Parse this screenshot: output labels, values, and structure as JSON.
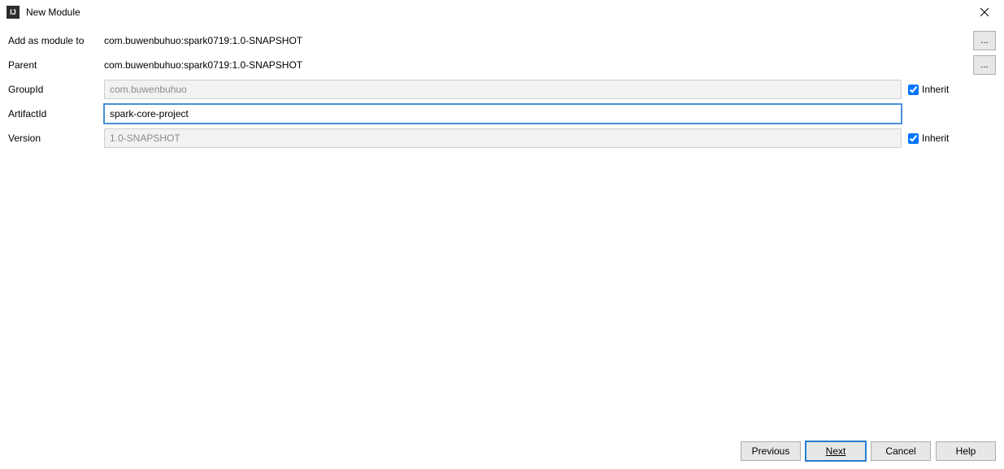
{
  "window": {
    "title": "New Module",
    "icon_label": "IJ"
  },
  "form": {
    "add_as_module_label": "Add as module to",
    "add_as_module_value": "com.buwenbuhuo:spark0719:1.0-SNAPSHOT",
    "parent_label": "Parent",
    "parent_value": "com.buwenbuhuo:spark0719:1.0-SNAPSHOT",
    "group_id_label": "GroupId",
    "group_id_value": "com.buwenbuhuo",
    "group_id_inherit": true,
    "artifact_id_label": "ArtifactId",
    "artifact_id_value": "spark-core-project",
    "version_label": "Version",
    "version_value": "1.0-SNAPSHOT",
    "version_inherit": true,
    "inherit_label": "Inherit",
    "browse_label": "..."
  },
  "footer": {
    "previous": "Previous",
    "next": "Next",
    "cancel": "Cancel",
    "help": "Help"
  }
}
